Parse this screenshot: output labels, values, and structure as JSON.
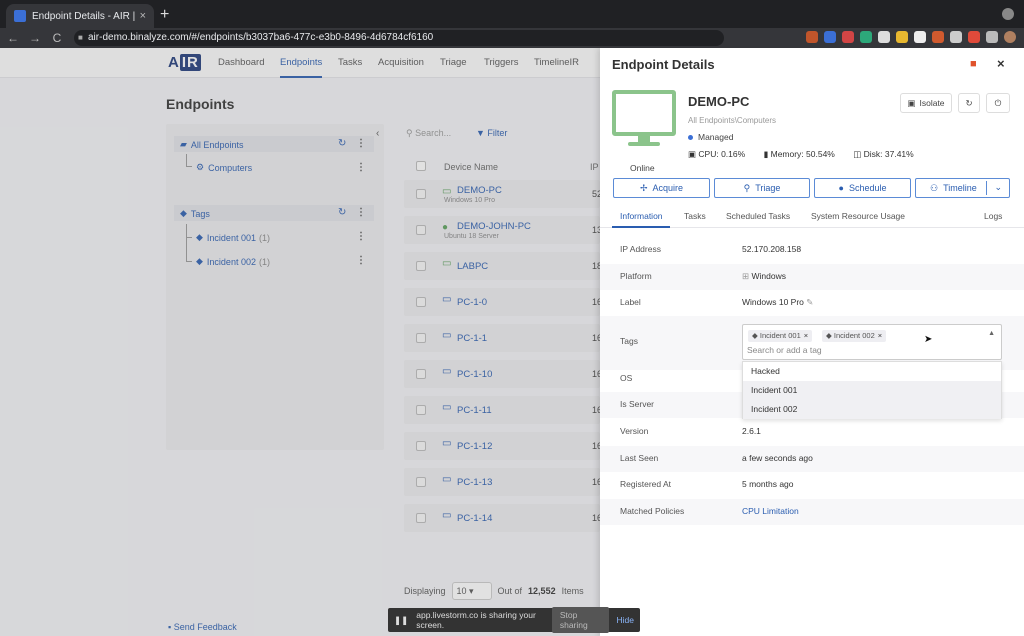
{
  "browser": {
    "tab_title": "Endpoint Details - AIR | Binalyz",
    "tab_close": "×",
    "new_tab": "+",
    "url": "air-demo.binalyze.com/#/endpoints/b3037ba6-477c-e3b0-8496-4d6784cf6160",
    "back": "←",
    "forward": "→",
    "reload": "C"
  },
  "app": {
    "logo_a": "A",
    "logo_ir": "IR",
    "nav": [
      "Dashboard",
      "Endpoints",
      "Tasks",
      "Acquisition",
      "Triage",
      "Triggers",
      "TimelineIR"
    ],
    "page_title": "Endpoints",
    "tree": {
      "all_endpoints": "All Endpoints",
      "computers": "Computers",
      "tags": "Tags",
      "tag_items": [
        {
          "label": "Incident 001",
          "count": "(1)"
        },
        {
          "label": "Incident 002",
          "count": "(1)"
        }
      ]
    },
    "search_placeholder": "Search...",
    "filter_label": "Filter",
    "columns": {
      "device_name": "Device Name",
      "ip": "IP"
    },
    "devices": [
      {
        "name": "DEMO-PC",
        "sub": "Windows 10 Pro",
        "ip": "52"
      },
      {
        "name": "DEMO-JOHN-PC",
        "sub": "Ubuntu 18 Server",
        "ip": "13"
      },
      {
        "name": "LABPC",
        "sub": "",
        "ip": "18"
      },
      {
        "name": "PC-1-0",
        "sub": "",
        "ip": "16"
      },
      {
        "name": "PC-1-1",
        "sub": "",
        "ip": "16"
      },
      {
        "name": "PC-1-10",
        "sub": "",
        "ip": "16"
      },
      {
        "name": "PC-1-11",
        "sub": "",
        "ip": "16"
      },
      {
        "name": "PC-1-12",
        "sub": "",
        "ip": "16"
      },
      {
        "name": "PC-1-13",
        "sub": "",
        "ip": "16"
      },
      {
        "name": "PC-1-14",
        "sub": "",
        "ip": "16"
      }
    ],
    "footer": {
      "displaying": "Displaying",
      "page_size": "10",
      "out_of": "Out of",
      "total": "12,552",
      "items": "Items"
    },
    "send_feedback": "Send Feedback"
  },
  "share_bar": {
    "text": "app.livestorm.co is sharing your screen.",
    "stop": "Stop sharing",
    "hide": "Hide"
  },
  "panel": {
    "title": "Endpoint Details",
    "name": "DEMO-PC",
    "path": "All Endpoints\\Computers",
    "managed": "Managed",
    "status": "Online",
    "cpu": "CPU: 0.16%",
    "memory": "Memory: 50.54%",
    "disk": "Disk: 37.41%",
    "isolate": "Isolate",
    "actions": {
      "acquire": "Acquire",
      "triage": "Triage",
      "schedule": "Schedule",
      "timeline": "Timeline"
    },
    "tabs": [
      "Information",
      "Tasks",
      "Scheduled Tasks",
      "System Resource Usage",
      "Logs"
    ],
    "info": {
      "ip_label": "IP Address",
      "ip_value": "52.170.208.158",
      "platform_label": "Platform",
      "platform_value": "Windows",
      "label_label": "Label",
      "label_value": "Windows 10 Pro",
      "tags_label": "Tags",
      "os_label": "OS",
      "server_label": "Is Server",
      "version_label": "Version",
      "version_value": "2.6.1",
      "lastseen_label": "Last Seen",
      "lastseen_value": "a few seconds ago",
      "registered_label": "Registered At",
      "registered_value": "5 months ago",
      "policies_label": "Matched Policies",
      "policies_value": "CPU Limitation"
    },
    "tag_chips": [
      "Incident 001",
      "Incident 002"
    ],
    "tag_placeholder": "Search or add a tag",
    "tag_options": [
      "Hacked",
      "Incident 001",
      "Incident 002"
    ]
  },
  "colors": {
    "accent": "#2a5db0",
    "online_green": "#8bc48b",
    "delete_red": "#e0522b"
  }
}
